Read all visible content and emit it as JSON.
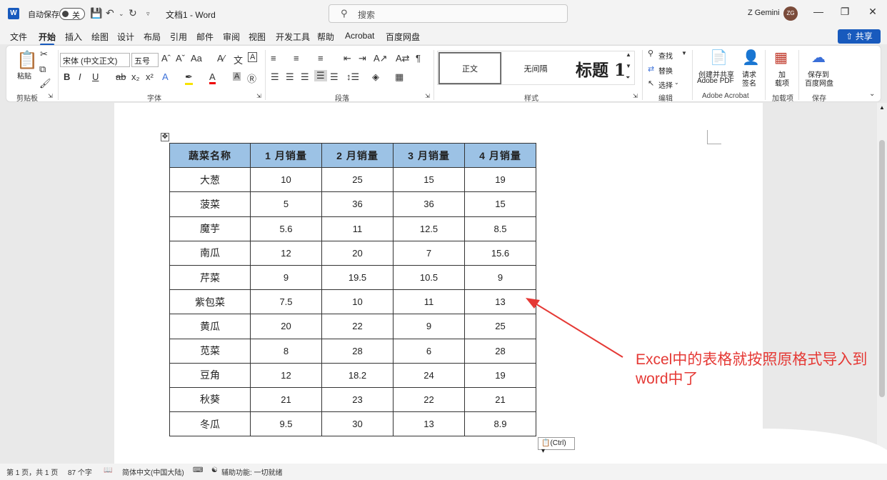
{
  "titlebar": {
    "autosave_label": "自动保存",
    "autosave_state": "关",
    "doc_title": "文档1 - Word",
    "search_placeholder": "搜索",
    "user_name": "Z Gemini",
    "avatar_initials": "ZG"
  },
  "menu": [
    "文件",
    "开始",
    "插入",
    "绘图",
    "设计",
    "布局",
    "引用",
    "邮件",
    "审阅",
    "视图",
    "开发工具",
    "帮助",
    "Acrobat",
    "百度网盘"
  ],
  "active_menu": "开始",
  "share_label": "共享",
  "ribbon": {
    "paste_label": "粘贴",
    "font_name": "宋体 (中文正文)",
    "font_size": "五号",
    "styles": [
      "正文",
      "无间隔",
      "标题 1"
    ],
    "find_label": "查找",
    "replace_label": "替换",
    "select_label": "选择",
    "create_pdf": [
      "创建并共享",
      "Adobe PDF"
    ],
    "request_sign": [
      "请求",
      "签名"
    ],
    "addin": [
      "加",
      "载项"
    ],
    "save_baidu": [
      "保存到",
      "百度网盘"
    ],
    "groups": [
      "剪贴板",
      "字体",
      "段落",
      "样式",
      "编辑",
      "Adobe Acrobat",
      "加载项",
      "保存"
    ]
  },
  "table": {
    "headers": [
      "蔬菜名称",
      "1 月销量",
      "2 月销量",
      "3 月销量",
      "4 月销量"
    ],
    "rows": [
      [
        "大葱",
        "10",
        "25",
        "15",
        "19"
      ],
      [
        "菠菜",
        "5",
        "36",
        "36",
        "15"
      ],
      [
        "魔芋",
        "5.6",
        "11",
        "12.5",
        "8.5"
      ],
      [
        "南瓜",
        "12",
        "20",
        "7",
        "15.6"
      ],
      [
        "芹菜",
        "9",
        "19.5",
        "10.5",
        "9"
      ],
      [
        "紫包菜",
        "7.5",
        "10",
        "11",
        "13"
      ],
      [
        "黄瓜",
        "20",
        "22",
        "9",
        "25"
      ],
      [
        "苋菜",
        "8",
        "28",
        "6",
        "28"
      ],
      [
        "豆角",
        "12",
        "18.2",
        "24",
        "19"
      ],
      [
        "秋葵",
        "21",
        "23",
        "22",
        "21"
      ],
      [
        "冬瓜",
        "9.5",
        "30",
        "13",
        "8.9"
      ]
    ]
  },
  "paste_options_label": "(Ctrl)",
  "annotation": "Excel中的表格就按照原格式导入到word中了",
  "statusbar": {
    "page": "第 1 页，共 1 页",
    "words": "87 个字",
    "language": "简体中文(中国大陆)",
    "accessibility": "辅助功能: 一切就绪"
  },
  "colors": {
    "accent": "#185abd",
    "header_fill": "#9cc2e5",
    "annotation": "#e53935"
  }
}
